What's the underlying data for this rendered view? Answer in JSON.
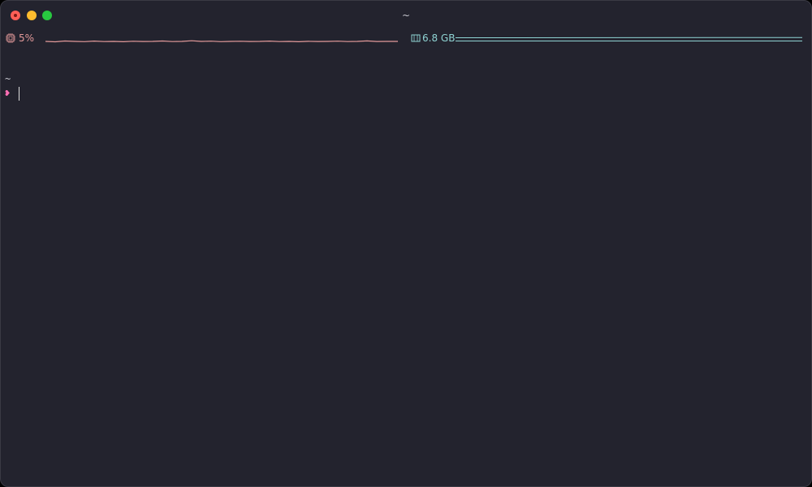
{
  "window": {
    "title": "~"
  },
  "statusbar": {
    "cpu": {
      "value_text": "5%",
      "icon": "cpu-chip-icon",
      "color": "#e39a9a"
    },
    "memory": {
      "value_text": "6.8 GB",
      "icon": "memory-icon",
      "color": "#8fd3d3"
    }
  },
  "terminal": {
    "cwd": "~",
    "prompt_glyph": "❥"
  },
  "colors": {
    "background": "#23232e",
    "prompt": "#ff6fb5"
  }
}
